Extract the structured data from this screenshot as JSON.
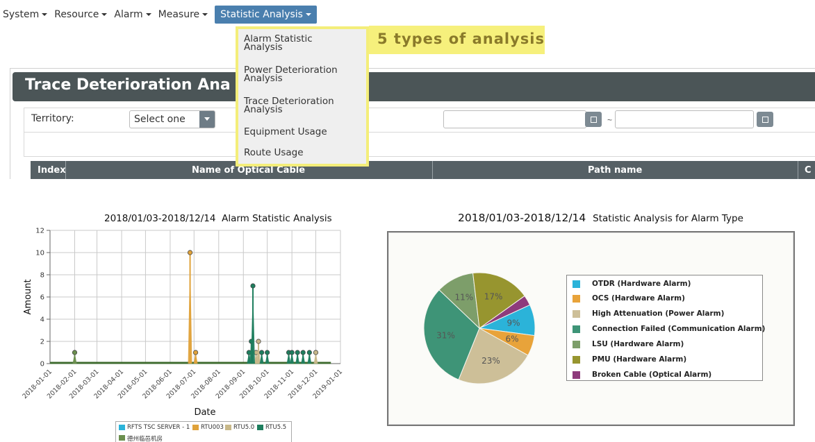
{
  "menu": {
    "items": [
      "System",
      "Resource",
      "Alarm",
      "Measure"
    ],
    "active": "Statistic Analysis"
  },
  "dropdown": {
    "items": [
      [
        "Alarm Statistic",
        "Analysis"
      ],
      [
        "Power Deterioration",
        "Analysis"
      ],
      [
        "Trace Deterioration",
        "Analysis"
      ],
      [
        "Equipment Usage"
      ],
      [
        "Route Usage"
      ]
    ]
  },
  "callout": "5 types of analysis",
  "page_title": "Trace Deterioration Ana",
  "filter": {
    "territory_label": "Territory:",
    "territory_value": "Select one",
    "date_separator": "~"
  },
  "table": {
    "headers": [
      "Index",
      "Name of Optical Cable",
      "Path name",
      "C"
    ]
  },
  "line_chart_title": {
    "range": "2018/01/03-2018/12/14",
    "name": "Alarm Statistic Analysis"
  },
  "pie_chart_title": {
    "range": "2018/01/03-2018/12/14",
    "name": "Statistic Analysis for Alarm Type"
  },
  "chart_data": [
    {
      "type": "line",
      "xlabel": "Date",
      "ylabel": "Amount",
      "ylim": [
        0,
        12
      ],
      "yticks": [
        0,
        2,
        4,
        6,
        8,
        10,
        12
      ],
      "xticks": [
        "2018-01-01",
        "2018-02-01",
        "2018-03-01",
        "2018-04-01",
        "2018-05-01",
        "2018-06-01",
        "2018-07-01",
        "2018-08-01",
        "2018-09-01",
        "2018-10-01",
        "2018-11-01",
        "2018-12-01",
        "2019-01-01"
      ],
      "grid": true,
      "legend_position": "bottom",
      "series": [
        {
          "name": "RFTS TSC SERVER - 1",
          "color": "#2bb3d9",
          "points": []
        },
        {
          "name": "RTU003",
          "color": "#e0a23a",
          "points": [
            [
              "2018-06-26",
              10
            ],
            [
              "2018-07-03",
              1
            ]
          ]
        },
        {
          "name": "RTU5.0",
          "color": "#c8b88a",
          "points": [
            [
              "2018-09-17",
              1
            ],
            [
              "2018-09-20",
              2
            ],
            [
              "2018-12-01",
              1
            ]
          ]
        },
        {
          "name": "RTU5.5",
          "color": "#1e7e5e",
          "points": [
            [
              "2018-09-08",
              1
            ],
            [
              "2018-09-11",
              2
            ],
            [
              "2018-09-13",
              7
            ],
            [
              "2018-09-24",
              1
            ],
            [
              "2018-10-01",
              1
            ],
            [
              "2018-10-28",
              1
            ],
            [
              "2018-11-01",
              1
            ],
            [
              "2018-11-08",
              1
            ],
            [
              "2018-11-15",
              1
            ],
            [
              "2018-11-23",
              1
            ]
          ]
        },
        {
          "name": "德州临邑机房",
          "color": "#6b8f4e",
          "points": [
            [
              "2018-02-01",
              1
            ]
          ]
        }
      ]
    },
    {
      "type": "pie",
      "legend_position": "right",
      "slices": [
        {
          "label": "OTDR  (Hardware Alarm)",
          "value": 9,
          "color": "#2bb3d9"
        },
        {
          "label": "OCS (Hardware Alarm)",
          "value": 6,
          "color": "#e8a33a"
        },
        {
          "label": "High Attenuation (Power Alarm)",
          "value": 23,
          "color": "#cdbf98"
        },
        {
          "label": "Connection Failed  (Communication Alarm)",
          "value": 31,
          "color": "#3e9477"
        },
        {
          "label": "LSU (Hardware Alarm)",
          "value": 11,
          "color": "#7d9e6a"
        },
        {
          "label": "PMU  (Hardware Alarm)",
          "value": 17,
          "color": "#97952f"
        },
        {
          "label": "Broken Cable (Optical Alarm)",
          "value": 3,
          "color": "#8e3b7c"
        }
      ]
    }
  ]
}
